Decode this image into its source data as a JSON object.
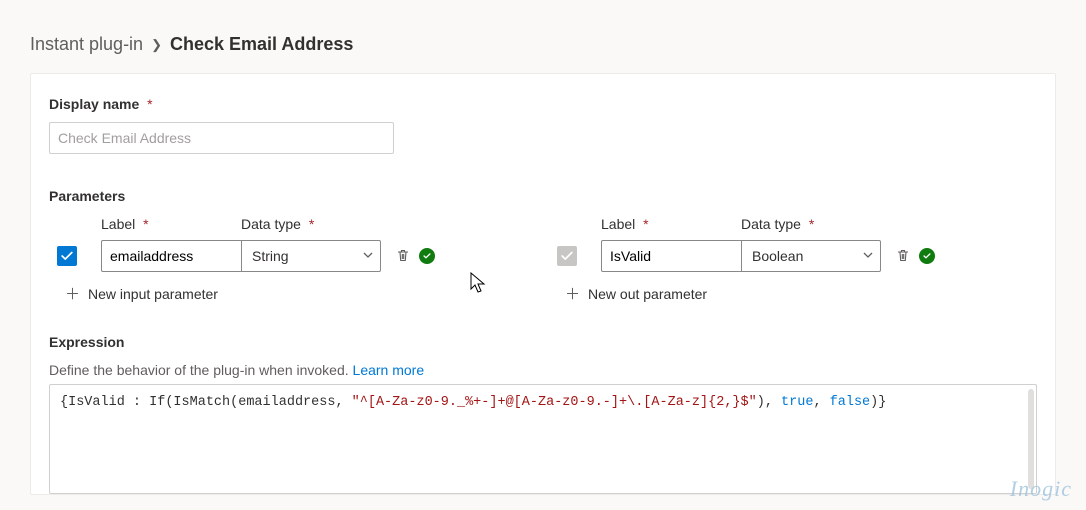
{
  "breadcrumb": {
    "parent": "Instant plug-in",
    "current": "Check Email Address"
  },
  "fields": {
    "displayName": {
      "label": "Display name",
      "placeholder": "Check Email Address"
    },
    "parameters": {
      "heading": "Parameters",
      "label_col": "Label",
      "type_col": "Data type",
      "input": {
        "label_value": "emailaddress",
        "type_value": "String",
        "add_text": "New input parameter"
      },
      "output": {
        "label_value": "IsValid",
        "type_value": "Boolean",
        "add_text": "New out parameter"
      }
    },
    "expression": {
      "heading": "Expression",
      "help_text": "Define the behavior of the plug-in when invoked. ",
      "learn_more": "Learn more",
      "code_pre": "{IsValid : If(IsMatch(emailaddress, ",
      "code_str": "\"^[A-Za-z0-9._%+-]+@[A-Za-z0-9.-]+\\.[A-Za-z]{2,}$\"",
      "code_post1": "), ",
      "code_true": "true",
      "code_post2": ", ",
      "code_false": "false",
      "code_post3": ")}"
    }
  },
  "watermark": "Inogic"
}
